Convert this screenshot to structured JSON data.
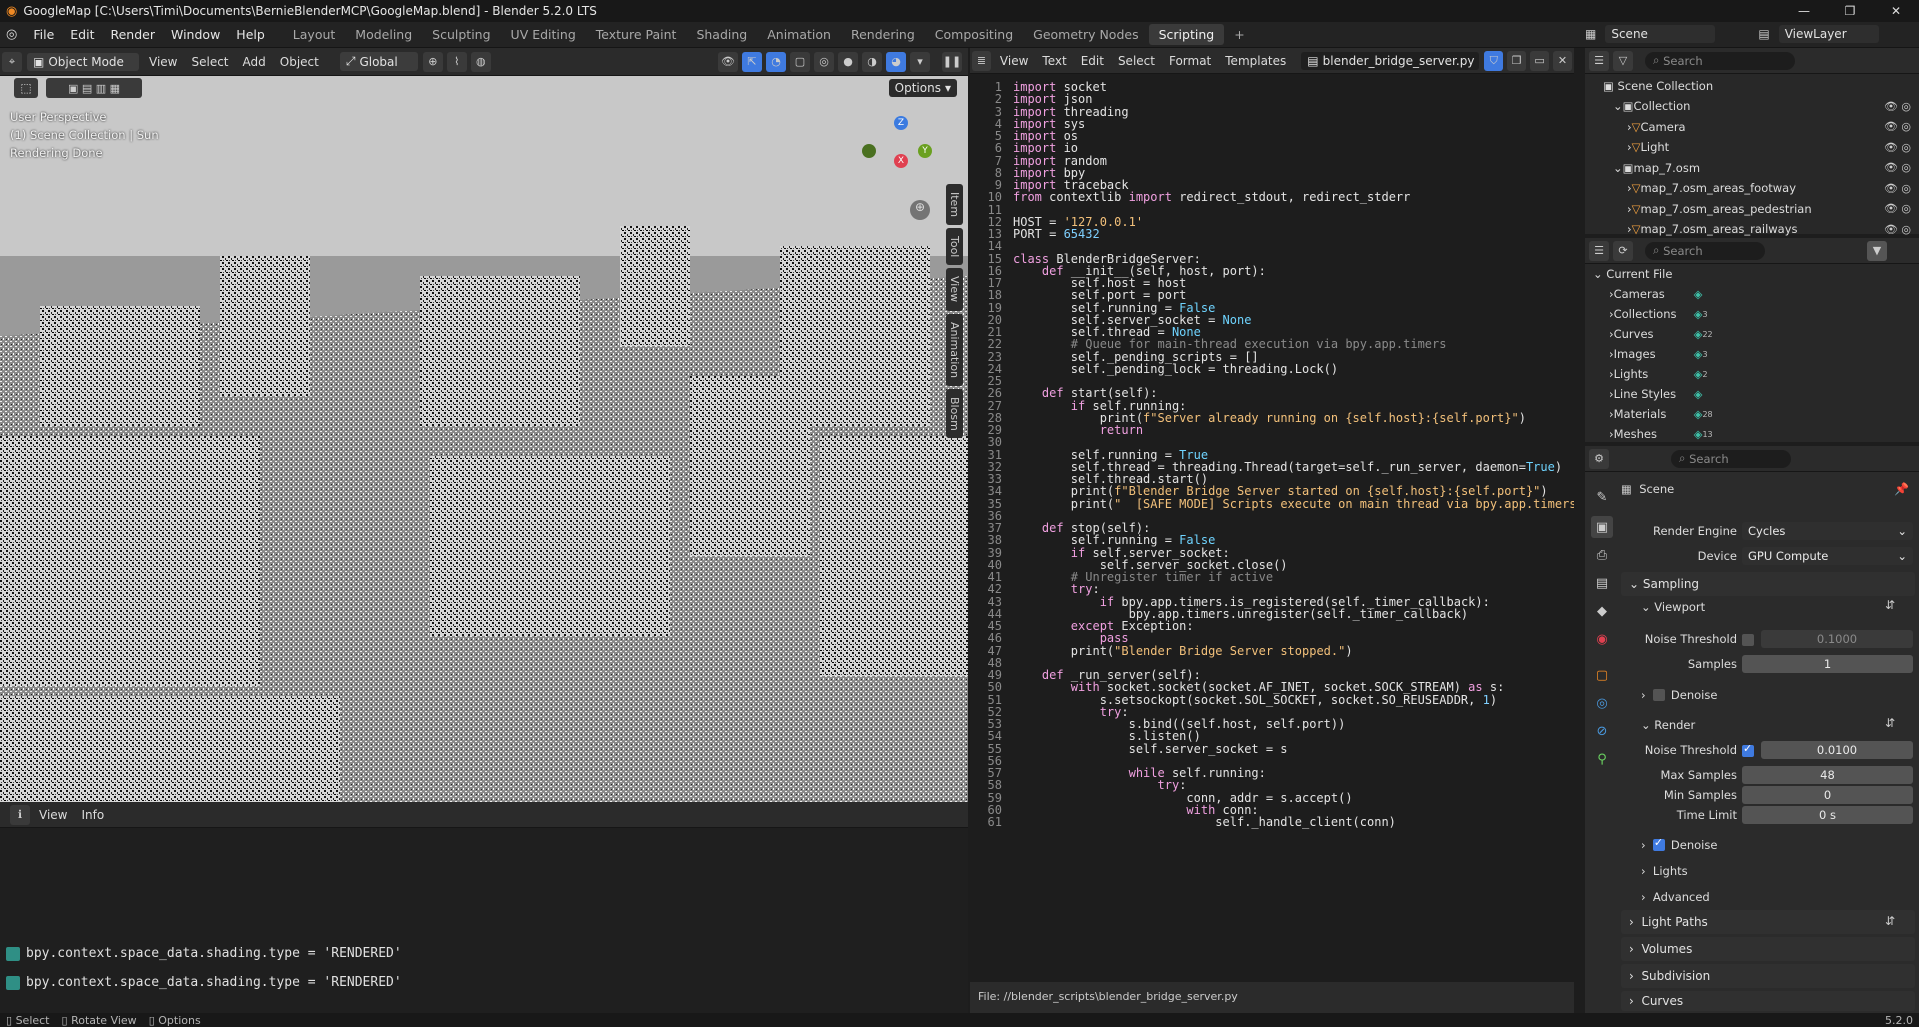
{
  "window": {
    "title": "GoogleMap [C:\\Users\\Timi\\Documents\\BernieBlenderMCP\\GoogleMap.blend] - Blender 5.2.0 LTS",
    "controls": [
      "—",
      "❐",
      "✕"
    ]
  },
  "menu": {
    "items": [
      "File",
      "Edit",
      "Render",
      "Window",
      "Help"
    ],
    "workspaces": [
      "Layout",
      "Modeling",
      "Sculpting",
      "UV Editing",
      "Texture Paint",
      "Shading",
      "Animation",
      "Rendering",
      "Compositing",
      "Geometry Nodes",
      "Scripting"
    ],
    "active_workspace": "Scripting",
    "add_tab": "+",
    "scene": "Scene",
    "view_layer": "ViewLayer"
  },
  "viewport": {
    "mode": "Object Mode",
    "menus": [
      "View",
      "Select",
      "Add",
      "Object"
    ],
    "orientation": "Global",
    "options": "Options",
    "overlay_lines": [
      "User Perspective",
      "(1) Scene Collection | Sun",
      "Rendering Done"
    ],
    "side_tabs": [
      "Item",
      "Tool",
      "View",
      "Animation",
      "Blosm"
    ],
    "gizmo": {
      "z": "Z",
      "y": "Y",
      "x": "X"
    }
  },
  "console": {
    "menus": [
      "View",
      "Info"
    ],
    "lines": [
      "bpy.context.space_data.shading.type = 'RENDERED'",
      "bpy.context.space_data.shading.type = 'RENDERED'"
    ]
  },
  "text_editor": {
    "menus": [
      "View",
      "Text",
      "Edit",
      "Select",
      "Format",
      "Templates"
    ],
    "filename": "blender_bridge_server.py",
    "footer": "File: //blender_scripts\\blender_bridge_server.py",
    "lines": [
      "import socket",
      "import json",
      "import threading",
      "import sys",
      "import os",
      "import io",
      "import random",
      "import bpy",
      "import traceback",
      "from contextlib import redirect_stdout, redirect_stderr",
      "",
      "HOST = '127.0.0.1'",
      "PORT = 65432",
      "",
      "class BlenderBridgeServer:",
      "    def __init__(self, host, port):",
      "        self.host = host",
      "        self.port = port",
      "        self.running = False",
      "        self.server_socket = None",
      "        self.thread = None",
      "        # Queue for main-thread execution via bpy.app.timers",
      "        self._pending_scripts = []",
      "        self._pending_lock = threading.Lock()",
      "",
      "    def start(self):",
      "        if self.running:",
      "            print(f\"Server already running on {self.host}:{self.port}\")",
      "            return",
      "",
      "        self.running = True",
      "        self.thread = threading.Thread(target=self._run_server, daemon=True)",
      "        self.thread.start()",
      "        print(f\"Blender Bridge Server started on {self.host}:{self.port}\")",
      "        print(\"  [SAFE MODE] Scripts execute on main thread via bpy.app.timers\")",
      "",
      "    def stop(self):",
      "        self.running = False",
      "        if self.server_socket:",
      "            self.server_socket.close()",
      "        # Unregister timer if active",
      "        try:",
      "            if bpy.app.timers.is_registered(self._timer_callback):",
      "                bpy.app.timers.unregister(self._timer_callback)",
      "        except Exception:",
      "            pass",
      "        print(\"Blender Bridge Server stopped.\")",
      "",
      "    def _run_server(self):",
      "        with socket.socket(socket.AF_INET, socket.SOCK_STREAM) as s:",
      "            s.setsockopt(socket.SOL_SOCKET, socket.SO_REUSEADDR, 1)",
      "            try:",
      "                s.bind((self.host, self.port))",
      "                s.listen()",
      "                self.server_socket = s",
      "",
      "                while self.running:",
      "                    try:",
      "                        conn, addr = s.accept()",
      "                        with conn:",
      "                            self._handle_client(conn)"
    ]
  },
  "outliner": {
    "search_placeholder": "Search",
    "root": "Scene Collection",
    "items": [
      {
        "label": "Collection",
        "depth": 1
      },
      {
        "label": "Camera",
        "depth": 2
      },
      {
        "label": "Light",
        "depth": 2
      },
      {
        "label": "map_7.osm",
        "depth": 1
      },
      {
        "label": "map_7.osm_areas_footway",
        "depth": 2
      },
      {
        "label": "map_7.osm_areas_pedestrian",
        "depth": 2
      },
      {
        "label": "map_7.osm_areas_railways",
        "depth": 2
      }
    ]
  },
  "blend_file": {
    "search_placeholder": "Search",
    "root": "Current File",
    "items": [
      {
        "label": "Cameras",
        "count": ""
      },
      {
        "label": "Collections",
        "count": "3"
      },
      {
        "label": "Curves",
        "count": "22"
      },
      {
        "label": "Images",
        "count": "3"
      },
      {
        "label": "Lights",
        "count": "2"
      },
      {
        "label": "Line Styles",
        "count": ""
      },
      {
        "label": "Materials",
        "count": "28"
      },
      {
        "label": "Meshes",
        "count": "13"
      }
    ]
  },
  "properties": {
    "search_placeholder": "Search",
    "context": "Scene",
    "render_engine_label": "Render Engine",
    "render_engine": "Cycles",
    "device_label": "Device",
    "device": "GPU Compute",
    "sampling": "Sampling",
    "viewport": "Viewport",
    "vp_noise_label": "Noise Threshold",
    "vp_noise": "0.1000",
    "vp_samples_label": "Samples",
    "vp_samples": "1",
    "vp_denoise": "Denoise",
    "render": "Render",
    "r_noise_label": "Noise Threshold",
    "r_noise": "0.0100",
    "max_samples_label": "Max Samples",
    "max_samples": "48",
    "min_samples_label": "Min Samples",
    "min_samples": "0",
    "time_limit_label": "Time Limit",
    "time_limit": "0 s",
    "r_denoise": "Denoise",
    "lights": "Lights",
    "advanced": "Advanced",
    "light_paths": "Light Paths",
    "volumes": "Volumes",
    "subdivision": "Subdivision",
    "curves": "Curves"
  },
  "statusbar": {
    "select": "Select",
    "rotate": "Rotate View",
    "options": "Options",
    "version": "5.2.0"
  }
}
